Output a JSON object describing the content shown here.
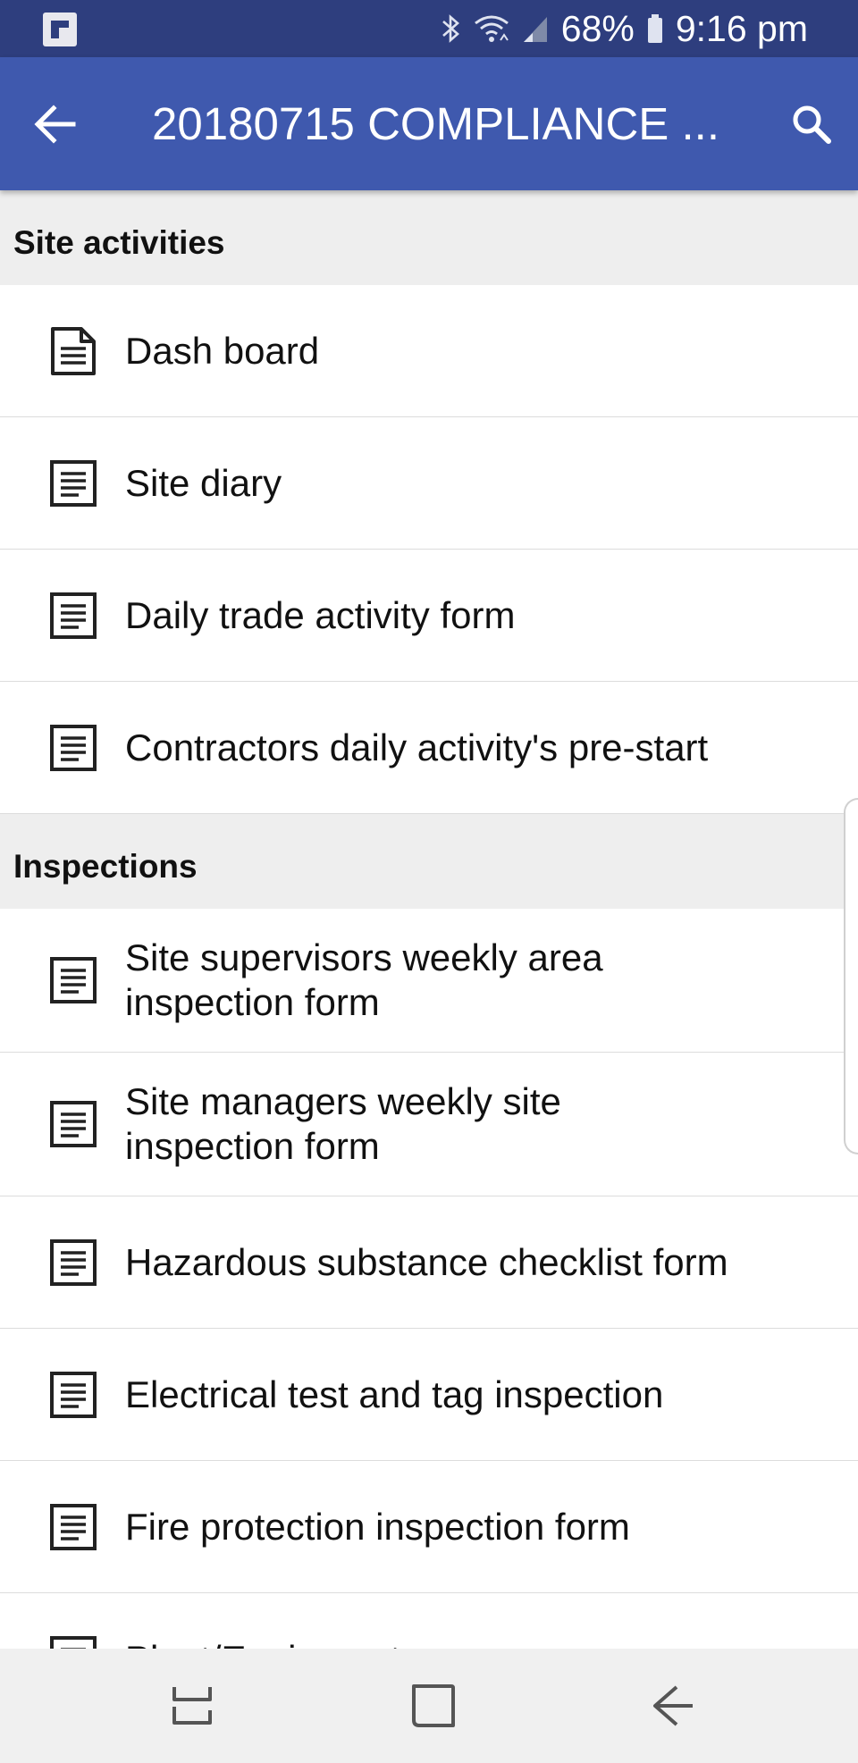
{
  "status_bar": {
    "battery": "68%",
    "time": "9:16 pm",
    "icons": [
      "app-notification-icon",
      "bluetooth-icon",
      "wifi-icon",
      "signal-icon",
      "battery-icon"
    ]
  },
  "app_bar": {
    "title": "20180715 COMPLIANCE ...",
    "back_icon": "arrow-back-icon",
    "search_icon": "search-icon",
    "background": "#3f59ae"
  },
  "sections": [
    {
      "title": "Site activities",
      "items": [
        {
          "label": "Dash board",
          "icon": "document-icon"
        },
        {
          "label": "Site diary",
          "icon": "form-icon"
        },
        {
          "label": "Daily trade activity form",
          "icon": "form-icon"
        },
        {
          "label": "Contractors daily activity's pre-start",
          "icon": "form-icon"
        }
      ]
    },
    {
      "title": "Inspections",
      "items": [
        {
          "label": "Site supervisors weekly area inspection form",
          "icon": "form-icon"
        },
        {
          "label": "Site managers weekly site inspection form",
          "icon": "form-icon"
        },
        {
          "label": "Hazardous substance checklist form",
          "icon": "form-icon"
        },
        {
          "label": "Electrical test and tag inspection",
          "icon": "form-icon"
        },
        {
          "label": "Fire protection inspection form",
          "icon": "form-icon"
        },
        {
          "label": "Plant/Equipment ...",
          "icon": "form-icon"
        }
      ]
    }
  ],
  "nav_bar": {
    "buttons": [
      "recent-apps-icon",
      "home-icon",
      "nav-back-icon"
    ]
  }
}
